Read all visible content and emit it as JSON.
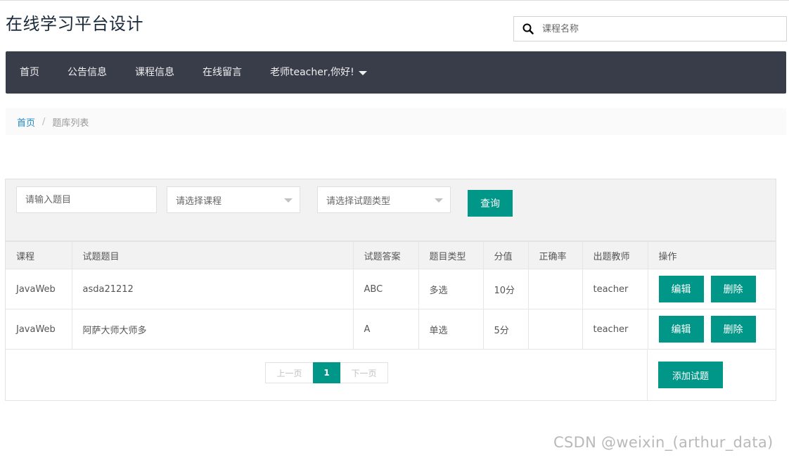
{
  "site": {
    "title": "在线学习平台设计"
  },
  "search": {
    "placeholder": "课程名称",
    "icon": "search-icon"
  },
  "nav": {
    "items": [
      "首页",
      "公告信息",
      "课程信息",
      "在线留言"
    ],
    "user_menu": "老师teacher,你好!"
  },
  "breadcrumb": {
    "home": "首页",
    "separator": "/",
    "current": "题库列表"
  },
  "filters": {
    "question_placeholder": "请输入题目",
    "course_placeholder": "请选择课程",
    "type_placeholder": "请选择试题类型",
    "query_label": "查询"
  },
  "table": {
    "headers": [
      "课程",
      "试题题目",
      "试题答案",
      "题目类型",
      "分值",
      "正确率",
      "出题教师",
      "操作"
    ],
    "rows": [
      {
        "course": "JavaWeb",
        "title": "asda21212",
        "answer": "ABC",
        "type": "多选",
        "score": "10分",
        "accuracy": "",
        "teacher": "teacher",
        "edit": "编辑",
        "delete": "删除"
      },
      {
        "course": "JavaWeb",
        "title": "阿萨大师大师多",
        "answer": "A",
        "type": "单选",
        "score": "5分",
        "accuracy": "",
        "teacher": "teacher",
        "edit": "编辑",
        "delete": "删除"
      }
    ]
  },
  "pager": {
    "prev": "上一页",
    "current": "1",
    "next": "下一页"
  },
  "add_button": "添加试题",
  "watermark": "CSDN @weixin_(arthur_data)",
  "colors": {
    "primary": "#009688",
    "navbar": "#393d49",
    "link": "#1e88c7"
  }
}
